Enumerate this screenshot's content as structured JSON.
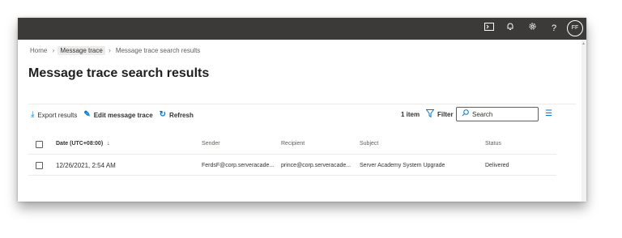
{
  "header": {
    "avatar_initials": "FF",
    "icons": [
      "terminal-icon",
      "bell-icon",
      "gear-icon",
      "help-icon"
    ]
  },
  "breadcrumb": [
    "Home",
    "Message trace",
    "Message trace search results"
  ],
  "page": {
    "title": "Message trace search results"
  },
  "toolbar": {
    "export_label": "Export results",
    "edit_label": "Edit message trace",
    "refresh_label": "Refresh",
    "item_count": "1 item",
    "filter_label": "Filter",
    "search_placeholder": "Search"
  },
  "table": {
    "columns": [
      "Date (UTC+08:00)",
      "Sender",
      "Recipient",
      "Subject",
      "Status"
    ],
    "sort_indicator": "↓",
    "rows": [
      {
        "date": "12/26/2021, 2:54 AM",
        "sender": "FerdsF@corp.serveracade...",
        "recipient": "prince@corp.serveracade...",
        "subject": "Server Academy System Upgrade",
        "status": "Delivered"
      }
    ]
  },
  "colors": {
    "topbar": "#3b3a39",
    "accent": "#0078d4"
  }
}
